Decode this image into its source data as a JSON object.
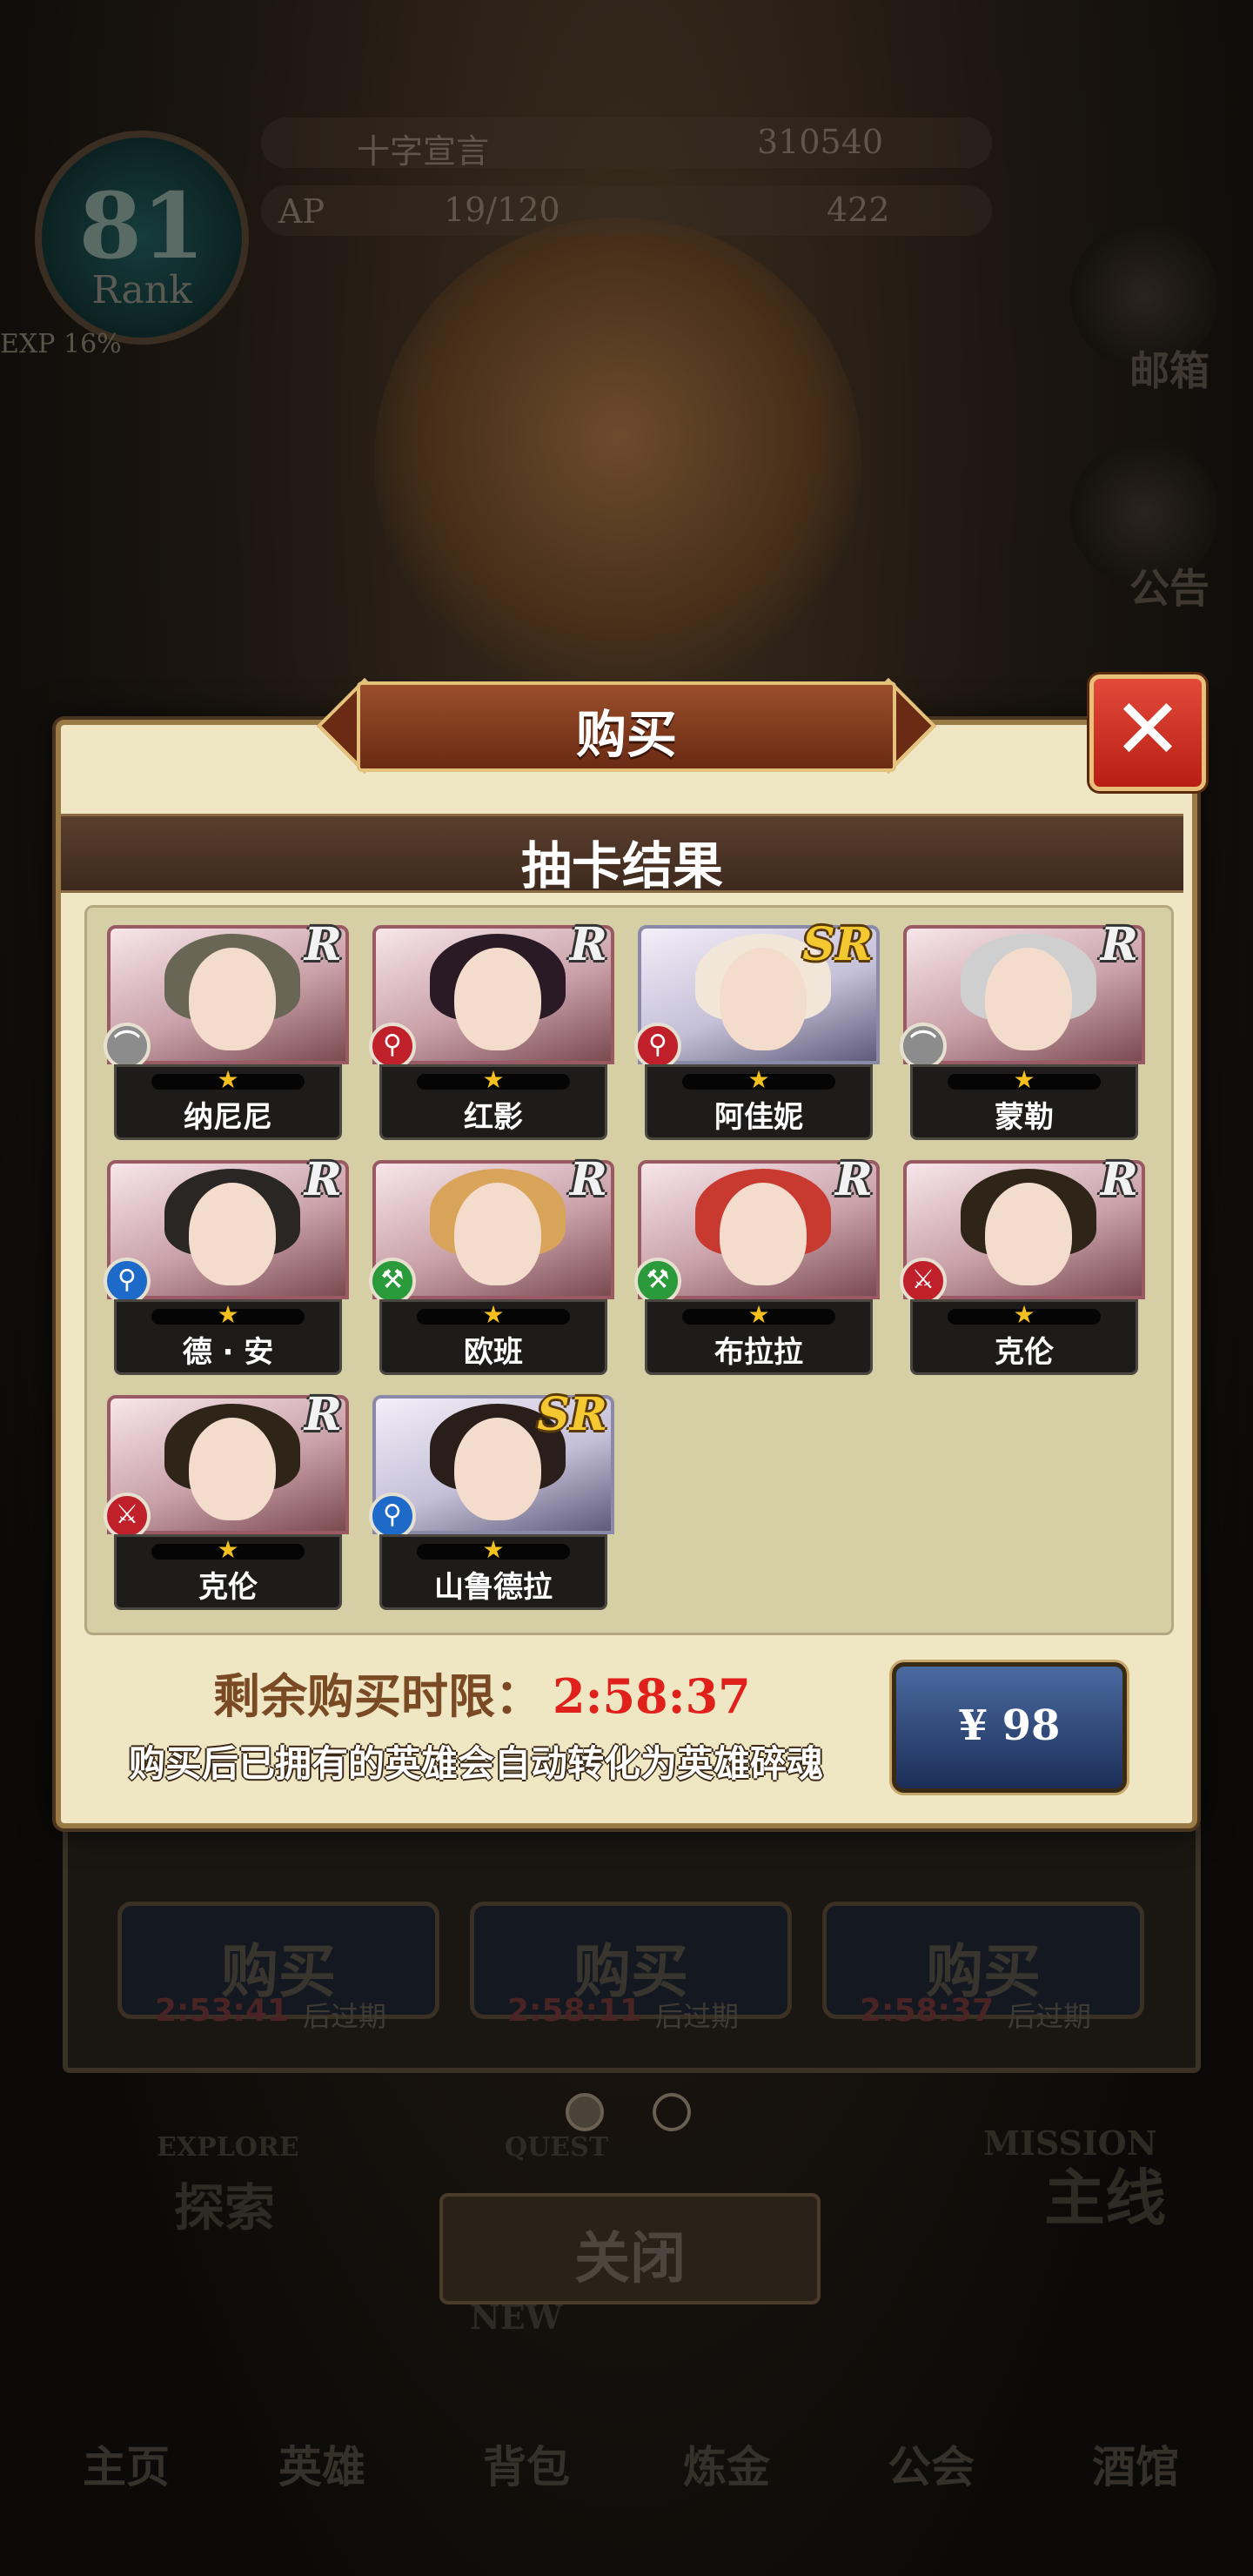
{
  "background": {
    "player_name": "十字宣言",
    "gold": "310540",
    "ap": "19/120",
    "gems": "422",
    "rank_number": "81",
    "rank_label": "Rank",
    "exp_label": "EXP 16%",
    "ap_label": "AP",
    "mail_label": "邮箱",
    "notice_label": "公告",
    "buy_buttons": [
      {
        "label": "购买",
        "timer": "2:53:41",
        "suffix": "后过期"
      },
      {
        "label": "购买",
        "timer": "2:58:11",
        "suffix": "后过期"
      },
      {
        "label": "购买",
        "timer": "2:58:37",
        "suffix": "后过期"
      }
    ],
    "mission_label": "MISSION",
    "main_line_label": "主线",
    "explore_label": "EXPLORE",
    "explore_text": "探索",
    "quest_label": "QUEST",
    "close_label": "关闭",
    "new_label": "NEW",
    "nav": [
      "主页",
      "英雄",
      "背包",
      "炼金",
      "公会",
      "酒馆"
    ]
  },
  "modal": {
    "title": "购买",
    "close_symbol": "✕",
    "subtitle": "抽卡结果",
    "cards": [
      {
        "name": "纳尼尼",
        "rarity": "R",
        "weapon": "bow",
        "weapon_color": "#8c8c8c",
        "hair": "#6a6656",
        "stars": 1
      },
      {
        "name": "红影",
        "rarity": "R",
        "weapon": "staff",
        "weapon_color": "#c0202a",
        "hair": "#2a1a26",
        "stars": 1
      },
      {
        "name": "阿佳妮",
        "rarity": "SR",
        "weapon": "staff",
        "weapon_color": "#c0202a",
        "hair": "#f2e6d8",
        "stars": 1
      },
      {
        "name": "蒙勒",
        "rarity": "R",
        "weapon": "bow",
        "weapon_color": "#8c8c8c",
        "hair": "#cfcfcf",
        "stars": 1
      },
      {
        "name": "德 · 安",
        "rarity": "R",
        "weapon": "staff",
        "weapon_color": "#1e6ac8",
        "hair": "#2a2624",
        "stars": 1
      },
      {
        "name": "欧班",
        "rarity": "R",
        "weapon": "axe",
        "weapon_color": "#2a9a3a",
        "hair": "#d8a45a",
        "stars": 1
      },
      {
        "name": "布拉拉",
        "rarity": "R",
        "weapon": "axe",
        "weapon_color": "#2a9a3a",
        "hair": "#c83a30",
        "stars": 1
      },
      {
        "name": "克伦",
        "rarity": "R",
        "weapon": "sword",
        "weapon_color": "#c0202a",
        "hair": "#2e2418",
        "stars": 1
      },
      {
        "name": "克伦",
        "rarity": "R",
        "weapon": "sword",
        "weapon_color": "#c0202a",
        "hair": "#2e2418",
        "stars": 1
      },
      {
        "name": "山鲁德拉",
        "rarity": "SR",
        "weapon": "staff",
        "weapon_color": "#1e6ac8",
        "hair": "#2a1e1a",
        "stars": 1
      }
    ],
    "timer_label": "剩余购买时限：",
    "timer_value": "2:58:37",
    "note": "购买后已拥有的英雄会自动转化为英雄碎魂",
    "price": "¥ 98"
  }
}
